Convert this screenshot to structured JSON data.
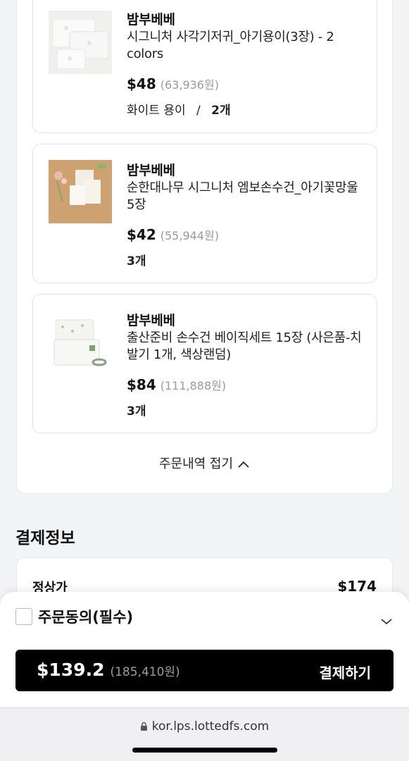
{
  "order": {
    "items": [
      {
        "brand": "밤부베베",
        "name": "시그니처 사각기저귀_아기용이(3장) - 2 colors",
        "price": "$48",
        "price_krw": "(63,936원)",
        "option_color": "화이트 용이",
        "option_sep": "/",
        "quantity": "2개"
      },
      {
        "brand": "밤부베베",
        "name": "순한대나무 시그니처 엠보손수건_아기꽃망울 5장",
        "price": "$42",
        "price_krw": "(55,944원)",
        "quantity": "3개"
      },
      {
        "brand": "밤부베베",
        "name": "출산준비 손수건 베이직세트 15장 (사은품-치발기 1개, 색상랜덤)",
        "price": "$84",
        "price_krw": "(111,888원)",
        "quantity": "3개"
      }
    ],
    "collapse_label": "주문내역 접기"
  },
  "payment": {
    "title": "결제정보",
    "regular_price_label": "정상가",
    "regular_price_value": "$174"
  },
  "checkout": {
    "agree_label": "주문동의(필수)",
    "total": "$139.2",
    "total_krw": "(185,410원)",
    "pay_label": "결제하기"
  },
  "browser": {
    "url": "kor.lps.lottedfs.com"
  },
  "icons": {
    "collapse": "chevron-up-icon",
    "expand": "chevron-down-icon",
    "lock": "lock-icon"
  }
}
